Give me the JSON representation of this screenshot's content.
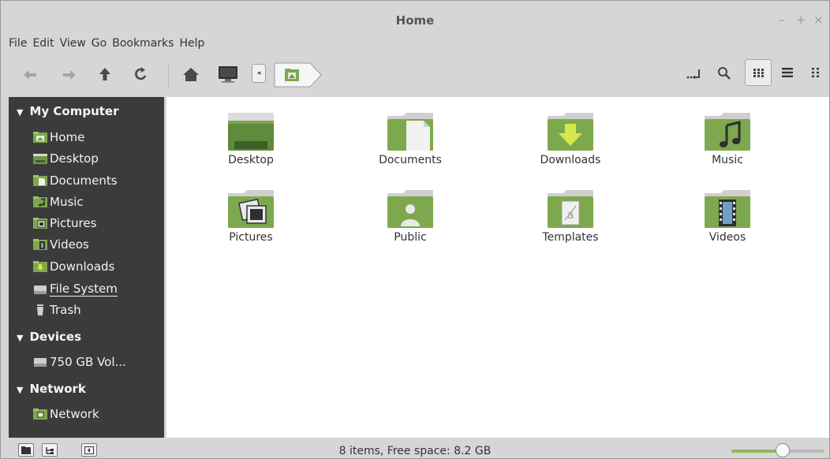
{
  "window": {
    "title": "Home",
    "minimize": "–",
    "maximize": "+",
    "close": "×"
  },
  "menu": [
    "File",
    "Edit",
    "View",
    "Go",
    "Bookmarks",
    "Help"
  ],
  "toolbar": {
    "icons": [
      "back-arrow-icon",
      "forward-arrow-icon",
      "up-arrow-icon",
      "reload-icon",
      "home-icon",
      "computer-icon",
      "path-left-arrow-icon",
      "home-folder-crumb-icon",
      "toggle-location-icon",
      "search-icon",
      "icon-view-icon",
      "list-view-icon",
      "compact-view-icon"
    ]
  },
  "sidebar": {
    "sections": [
      {
        "title": "My Computer",
        "items": [
          "Home",
          "Desktop",
          "Documents",
          "Music",
          "Pictures",
          "Videos",
          "Downloads",
          "File System",
          "Trash"
        ]
      },
      {
        "title": "Devices",
        "items": [
          "750 GB Vol..."
        ]
      },
      {
        "title": "Network",
        "items": [
          "Network"
        ]
      }
    ]
  },
  "files": [
    {
      "name": "Desktop",
      "icon": "desktop-folder-icon"
    },
    {
      "name": "Documents",
      "icon": "documents-folder-icon"
    },
    {
      "name": "Downloads",
      "icon": "downloads-folder-icon"
    },
    {
      "name": "Music",
      "icon": "music-folder-icon"
    },
    {
      "name": "Pictures",
      "icon": "pictures-folder-icon"
    },
    {
      "name": "Public",
      "icon": "public-folder-icon"
    },
    {
      "name": "Templates",
      "icon": "templates-folder-icon"
    },
    {
      "name": "Videos",
      "icon": "videos-folder-icon"
    }
  ],
  "status": {
    "text": "8 items, Free space: 8.2 GB",
    "zoom_fraction": 0.55
  },
  "colors": {
    "accent": "#8fb85a",
    "sidebar_bg": "#3b3b3b",
    "folder_green": "#7ea84e"
  }
}
